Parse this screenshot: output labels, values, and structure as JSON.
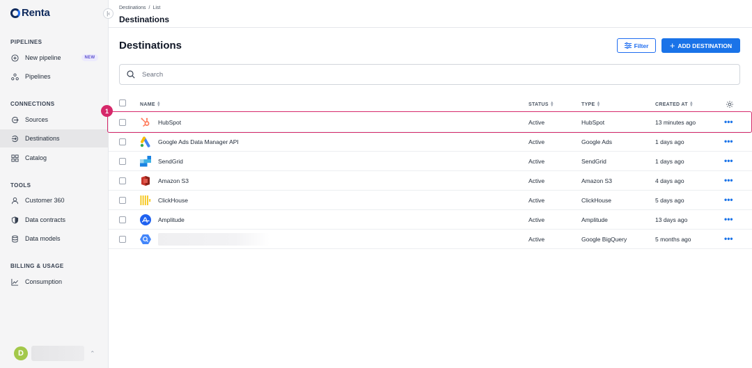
{
  "app": {
    "name": "Renta"
  },
  "sidebar": {
    "sections": [
      {
        "label": "PIPELINES",
        "items": [
          {
            "label": "New pipeline",
            "badge": "NEW",
            "icon": "plus-circle-icon"
          },
          {
            "label": "Pipelines",
            "icon": "pipelines-icon"
          }
        ]
      },
      {
        "label": "CONNECTIONS",
        "items": [
          {
            "label": "Sources",
            "icon": "source-icon"
          },
          {
            "label": "Destinations",
            "icon": "destination-icon",
            "active": true
          },
          {
            "label": "Catalog",
            "icon": "catalog-icon"
          }
        ]
      },
      {
        "label": "TOOLS",
        "items": [
          {
            "label": "Customer 360",
            "icon": "user-icon"
          },
          {
            "label": "Data contracts",
            "icon": "shield-icon"
          },
          {
            "label": "Data models",
            "icon": "database-icon"
          }
        ]
      },
      {
        "label": "BILLING & USAGE",
        "items": [
          {
            "label": "Consumption",
            "icon": "chart-line-icon"
          }
        ]
      }
    ],
    "user": {
      "initial": "D"
    }
  },
  "header": {
    "breadcrumb": [
      "Destinations",
      "/",
      "List"
    ],
    "title": "Destinations"
  },
  "main": {
    "title": "Destinations",
    "filter_label": "Filter",
    "add_label": "ADD DESTINATION",
    "search_placeholder": "Search",
    "columns": [
      "NAME",
      "STATUS",
      "TYPE",
      "CREATED AT"
    ],
    "rows": [
      {
        "name": "HubSpot",
        "status": "Active",
        "type": "HubSpot",
        "created": "13 minutes ago",
        "icon": "hubspot-icon"
      },
      {
        "name": "Google Ads Data Manager API",
        "status": "Active",
        "type": "Google Ads",
        "created": "1 days ago",
        "icon": "google-ads-icon"
      },
      {
        "name": "SendGrid",
        "status": "Active",
        "type": "SendGrid",
        "created": "1 days ago",
        "icon": "sendgrid-icon"
      },
      {
        "name": "Amazon S3",
        "status": "Active",
        "type": "Amazon S3",
        "created": "4 days ago",
        "icon": "amazon-s3-icon"
      },
      {
        "name": "ClickHouse",
        "status": "Active",
        "type": "ClickHouse",
        "created": "5 days ago",
        "icon": "clickhouse-icon"
      },
      {
        "name": "Amplitude",
        "status": "Active",
        "type": "Amplitude",
        "created": "13 days ago",
        "icon": "amplitude-icon"
      },
      {
        "name": "",
        "status": "Active",
        "type": "Google BigQuery",
        "created": "5 months ago",
        "icon": "bigquery-icon"
      }
    ],
    "more_label": "•••",
    "annotation": "1"
  },
  "colors": {
    "accent": "#1a73e8",
    "highlight": "#d6286a",
    "sidebar_bg": "#f5f5f6"
  }
}
